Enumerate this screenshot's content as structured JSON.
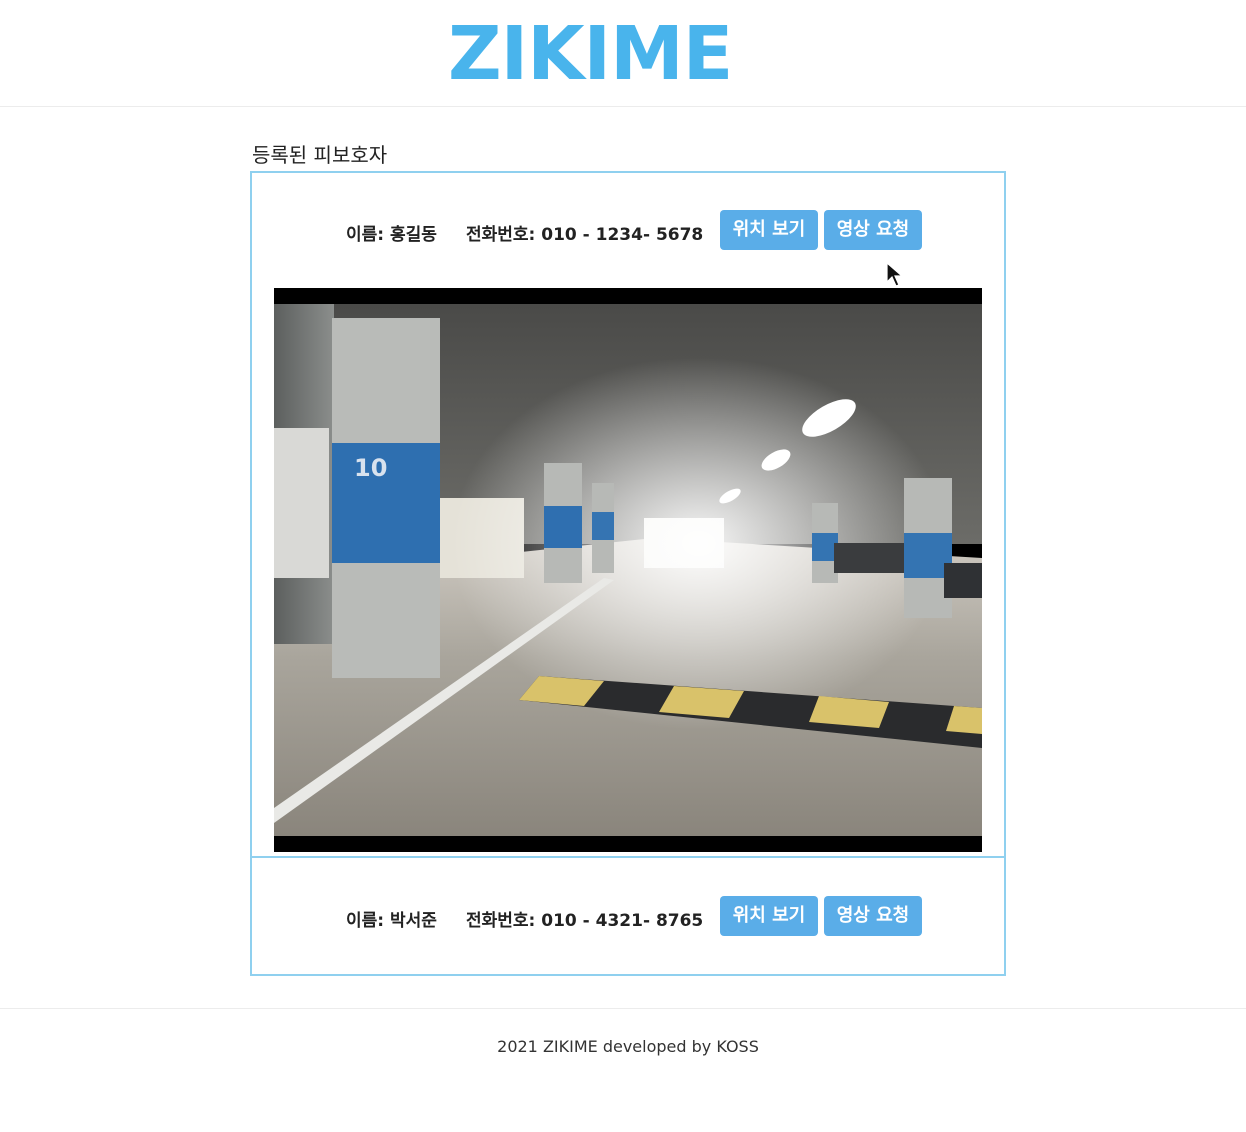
{
  "header": {
    "logo": "ZIKIME"
  },
  "section": {
    "title": "등록된 피보호자"
  },
  "wards": [
    {
      "name_label": "이름: 홍길동",
      "phone_label": "전화번호: 010 - 1234- 5678",
      "location_button": "위치 보기",
      "video_button": "영상 요청",
      "video_visible": true
    },
    {
      "name_label": "이름: 박서준",
      "phone_label": "전화번호: 010 - 4321- 8765",
      "location_button": "위치 보기",
      "video_button": "영상 요청",
      "video_visible": false
    }
  ],
  "video_overlay": {
    "pillar_number": "10"
  },
  "footer": {
    "text": "2021 ZIKIME developed by KOSS"
  },
  "colors": {
    "accent": "#49b4ec",
    "button": "#5aade8",
    "card_border": "#8fd0ef"
  }
}
